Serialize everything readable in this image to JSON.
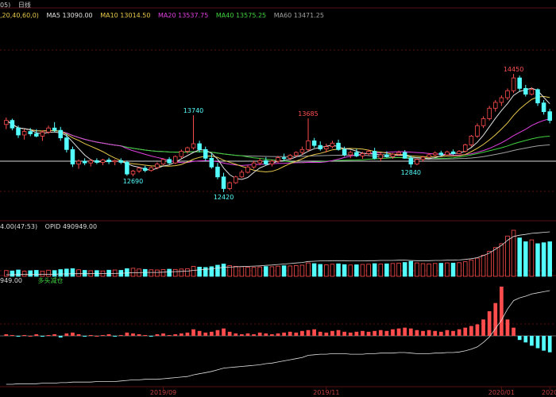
{
  "colors": {
    "background": "#000000",
    "grid": "#5a1010",
    "up": "#ff4d4d",
    "down": "#54ffff",
    "ma5": "#e0e0e0",
    "ma10": "#e6c84a",
    "ma20": "#e040e0",
    "ma40": "#40d040",
    "ma60": "#a0a0a0",
    "label_cyan": "#54ffff",
    "label_red": "#ff5050",
    "signal_green": "#40d040"
  },
  "header": {
    "period_suffix": "05)",
    "interval_label": "日线",
    "ma_params": ",20,40,60,0)",
    "ma5": "MA5 13090.00",
    "ma10": "MA10 13014.50",
    "ma20": "MA20 13537.75",
    "ma40": "MA40 13575.25",
    "ma60": "MA60 13471.25"
  },
  "volume_panel": {
    "label_left": "4.00(47:53)",
    "opid": "OPID 490949.00"
  },
  "position_panel": {
    "label_left": "949.00",
    "signal_label": "多头减仓"
  },
  "x_axis": {
    "labels": [
      "2019/09",
      "2019/11",
      "2020/01",
      "2020"
    ]
  },
  "price_labels": [
    {
      "text": "13740",
      "color": "down"
    },
    {
      "text": "13685",
      "color": "up"
    },
    {
      "text": "14450",
      "color": "up"
    },
    {
      "text": "12690",
      "color": "down"
    },
    {
      "text": "12420",
      "color": "down"
    },
    {
      "text": "12840",
      "color": "down"
    }
  ],
  "chart_data": {
    "type": "candlestick",
    "ohlc": [
      [
        13580,
        13700,
        13500,
        13650
      ],
      [
        13650,
        13680,
        13480,
        13520
      ],
      [
        13520,
        13560,
        13350,
        13400
      ],
      [
        13400,
        13500,
        13320,
        13460
      ],
      [
        13460,
        13520,
        13380,
        13420
      ],
      [
        13420,
        13500,
        13360,
        13380
      ],
      [
        13380,
        13480,
        13300,
        13450
      ],
      [
        13450,
        13560,
        13420,
        13520
      ],
      [
        13520,
        13620,
        13450,
        13480
      ],
      [
        13480,
        13540,
        13300,
        13350
      ],
      [
        13350,
        13420,
        13100,
        13150
      ],
      [
        13150,
        13200,
        12850,
        12900
      ],
      [
        12900,
        12980,
        12820,
        12950
      ],
      [
        12950,
        13000,
        12880,
        12920
      ],
      [
        12920,
        12990,
        12860,
        12960
      ],
      [
        12960,
        13000,
        12900,
        12930
      ],
      [
        12930,
        12990,
        12880,
        12970
      ],
      [
        12970,
        13010,
        12900,
        12940
      ],
      [
        12940,
        12980,
        12880,
        12960
      ],
      [
        12960,
        13000,
        12900,
        12930
      ],
      [
        12930,
        12960,
        12700,
        12730
      ],
      [
        12730,
        12800,
        12690,
        12780
      ],
      [
        12780,
        12850,
        12750,
        12830
      ],
      [
        12830,
        12870,
        12760,
        12790
      ],
      [
        12790,
        12860,
        12770,
        12840
      ],
      [
        12840,
        12930,
        12810,
        12900
      ],
      [
        12900,
        13000,
        12880,
        12980
      ],
      [
        12980,
        13020,
        12900,
        12920
      ],
      [
        12920,
        13050,
        12900,
        13030
      ],
      [
        13030,
        13150,
        13000,
        13120
      ],
      [
        13120,
        13200,
        13080,
        13180
      ],
      [
        13180,
        13740,
        13150,
        13250
      ],
      [
        13250,
        13300,
        13100,
        13150
      ],
      [
        13150,
        13200,
        12950,
        13000
      ],
      [
        13000,
        13080,
        12820,
        12850
      ],
      [
        12850,
        12920,
        12640,
        12680
      ],
      [
        12680,
        12750,
        12420,
        12480
      ],
      [
        12480,
        12600,
        12450,
        12580
      ],
      [
        12580,
        12700,
        12560,
        12680
      ],
      [
        12680,
        12800,
        12660,
        12760
      ],
      [
        12760,
        12880,
        12740,
        12850
      ],
      [
        12850,
        12960,
        12820,
        12920
      ],
      [
        12920,
        13000,
        12880,
        12960
      ],
      [
        12960,
        13020,
        12880,
        12900
      ],
      [
        12900,
        12980,
        12860,
        12950
      ],
      [
        12950,
        13040,
        12920,
        13010
      ],
      [
        13010,
        13080,
        12960,
        13000
      ],
      [
        13000,
        13070,
        12970,
        13050
      ],
      [
        13050,
        13120,
        13020,
        13100
      ],
      [
        13100,
        13200,
        13060,
        13150
      ],
      [
        13150,
        13685,
        13120,
        13300
      ],
      [
        13300,
        13350,
        13180,
        13220
      ],
      [
        13220,
        13290,
        13130,
        13160
      ],
      [
        13160,
        13250,
        13100,
        13200
      ],
      [
        13200,
        13300,
        13170,
        13260
      ],
      [
        13260,
        13320,
        13130,
        13150
      ],
      [
        13150,
        13200,
        13030,
        13060
      ],
      [
        13060,
        13130,
        13000,
        13100
      ],
      [
        13100,
        13160,
        13020,
        13040
      ],
      [
        13040,
        13110,
        12990,
        13080
      ],
      [
        13080,
        13150,
        13050,
        13120
      ],
      [
        13120,
        13180,
        12980,
        13000
      ],
      [
        13000,
        13090,
        12950,
        13060
      ],
      [
        13060,
        13120,
        13010,
        13030
      ],
      [
        13030,
        13090,
        12990,
        13070
      ],
      [
        13070,
        13130,
        13040,
        13100
      ],
      [
        13100,
        13140,
        12990,
        13000
      ],
      [
        13000,
        13050,
        12840,
        12900
      ],
      [
        12900,
        13000,
        12880,
        12980
      ],
      [
        12980,
        13040,
        12940,
        13020
      ],
      [
        13020,
        13090,
        13000,
        13060
      ],
      [
        13060,
        13120,
        13030,
        13090
      ],
      [
        13090,
        13130,
        13040,
        13060
      ],
      [
        13060,
        13130,
        13050,
        13110
      ],
      [
        13110,
        13150,
        13060,
        13080
      ],
      [
        13080,
        13140,
        13070,
        13120
      ],
      [
        13120,
        13250,
        13100,
        13230
      ],
      [
        13230,
        13400,
        13200,
        13380
      ],
      [
        13380,
        13600,
        13350,
        13560
      ],
      [
        13560,
        13720,
        13520,
        13680
      ],
      [
        13680,
        13900,
        13650,
        13860
      ],
      [
        13860,
        14000,
        13800,
        13960
      ],
      [
        13960,
        14080,
        13900,
        14040
      ],
      [
        14040,
        14200,
        14000,
        14160
      ],
      [
        14160,
        14450,
        14120,
        14380
      ],
      [
        14380,
        14420,
        14150,
        14200
      ],
      [
        14200,
        14260,
        14060,
        14100
      ],
      [
        14100,
        14220,
        14080,
        14180
      ],
      [
        14180,
        14200,
        13900,
        13950
      ],
      [
        13950,
        14000,
        13750,
        13800
      ],
      [
        13800,
        13850,
        13600,
        13650
      ]
    ],
    "volume": [
      30,
      28,
      33,
      27,
      29,
      31,
      26,
      32,
      30,
      35,
      38,
      40,
      34,
      31,
      29,
      30,
      28,
      32,
      33,
      31,
      40,
      42,
      38,
      36,
      34,
      33,
      35,
      37,
      36,
      38,
      40,
      52,
      48,
      46,
      50,
      58,
      64,
      56,
      52,
      50,
      48,
      47,
      49,
      51,
      50,
      53,
      55,
      54,
      56,
      58,
      70,
      66,
      62,
      60,
      63,
      65,
      61,
      59,
      60,
      62,
      63,
      66,
      64,
      65,
      67,
      69,
      72,
      78,
      70,
      66,
      65,
      67,
      68,
      70,
      69,
      71,
      76,
      85,
      95,
      110,
      130,
      150,
      170,
      210,
      240,
      200,
      180,
      190,
      170,
      175,
      180
    ],
    "open_interest": [
      10,
      10,
      11,
      11,
      11,
      11,
      12,
      12,
      12,
      13,
      13,
      14,
      14,
      14,
      14,
      15,
      15,
      15,
      15,
      16,
      17,
      18,
      18,
      19,
      19,
      19,
      20,
      21,
      22,
      23,
      24,
      27,
      29,
      31,
      33,
      36,
      39,
      40,
      41,
      42,
      43,
      44,
      45,
      47,
      48,
      50,
      52,
      54,
      56,
      58,
      62,
      63,
      64,
      64,
      65,
      65,
      65,
      64,
      64,
      64,
      65,
      65,
      66,
      66,
      66,
      67,
      67,
      66,
      65,
      65,
      65,
      66,
      66,
      67,
      67,
      68,
      70,
      73,
      77,
      85,
      95,
      110,
      125,
      145,
      160,
      165,
      168,
      172,
      174,
      176,
      178
    ],
    "position_change": [
      2,
      1,
      -1,
      1,
      0,
      2,
      -1,
      1,
      2,
      -2,
      3,
      4,
      2,
      -1,
      1,
      0,
      1,
      2,
      -1,
      1,
      4,
      3,
      2,
      1,
      -1,
      2,
      3,
      1,
      2,
      3,
      4,
      8,
      6,
      4,
      5,
      7,
      9,
      5,
      3,
      2,
      3,
      2,
      4,
      3,
      2,
      3,
      4,
      5,
      4,
      6,
      7,
      8,
      5,
      4,
      6,
      7,
      5,
      4,
      5,
      6,
      5,
      6,
      7,
      6,
      8,
      9,
      10,
      9,
      7,
      6,
      7,
      6,
      5,
      7,
      6,
      8,
      10,
      12,
      14,
      20,
      30,
      40,
      60,
      20,
      10,
      -5,
      -8,
      -12,
      -15,
      -18,
      -20
    ],
    "ma": {
      "ma5": 13090.0,
      "ma10": 13014.5,
      "ma20": 13537.75,
      "ma40": 13575.25,
      "ma60": 13471.25
    },
    "annotations": [
      {
        "text": "13740",
        "index": 31,
        "value": 13740
      },
      {
        "text": "13685",
        "index": 50,
        "value": 13685
      },
      {
        "text": "14450",
        "index": 84,
        "value": 14450
      },
      {
        "text": "12690",
        "index": 21,
        "value": 12690
      },
      {
        "text": "12420",
        "index": 36,
        "value": 12420
      },
      {
        "text": "12840",
        "index": 67,
        "value": 12840
      }
    ],
    "x_labels": [
      {
        "text": "2019/09",
        "index": 26
      },
      {
        "text": "2019/11",
        "index": 53
      },
      {
        "text": "2020/01",
        "index": 82
      },
      {
        "text": "2020",
        "index": 90
      }
    ]
  }
}
